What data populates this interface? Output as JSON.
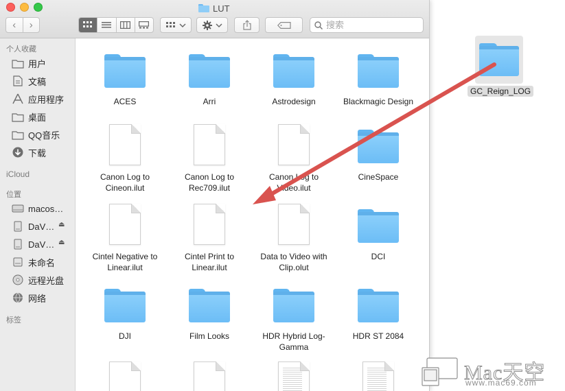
{
  "window": {
    "title": "LUT"
  },
  "toolbar": {
    "back_label": "‹",
    "forward_label": "›",
    "search_placeholder": "搜索"
  },
  "sidebar": {
    "favorites_header": "个人收藏",
    "favorites": [
      {
        "label": "用户",
        "icon": "home-icon"
      },
      {
        "label": "文稿",
        "icon": "document-icon"
      },
      {
        "label": "应用程序",
        "icon": "applications-icon"
      },
      {
        "label": "桌面",
        "icon": "desktop-icon"
      },
      {
        "label": "QQ音乐",
        "icon": "folder-icon"
      },
      {
        "label": "下载",
        "icon": "download-icon"
      }
    ],
    "icloud_header": "iCloud",
    "locations_header": "位置",
    "locations": [
      {
        "label": "macos…",
        "icon": "hard-drive-icon"
      },
      {
        "label": "DaV…",
        "icon": "disk-icon",
        "eject": true
      },
      {
        "label": "DaV…",
        "icon": "disk-icon",
        "eject": true
      },
      {
        "label": "未命名",
        "icon": "disk-icon"
      },
      {
        "label": "远程光盘",
        "icon": "remote-disc-icon"
      },
      {
        "label": "网络",
        "icon": "network-icon"
      }
    ],
    "tags_header": "标签"
  },
  "files": [
    {
      "name": "ACES",
      "kind": "folder"
    },
    {
      "name": "Arri",
      "kind": "folder"
    },
    {
      "name": "Astrodesign",
      "kind": "folder"
    },
    {
      "name": "Blackmagic Design",
      "kind": "folder"
    },
    {
      "name": "Canon Log to Cineon.ilut",
      "kind": "document"
    },
    {
      "name": "Canon Log to Rec709.ilut",
      "kind": "document"
    },
    {
      "name": "Canon Log to Video.ilut",
      "kind": "document"
    },
    {
      "name": "CineSpace",
      "kind": "folder"
    },
    {
      "name": "Cintel Negative to Linear.ilut",
      "kind": "document"
    },
    {
      "name": "Cintel Print to Linear.ilut",
      "kind": "document"
    },
    {
      "name": "Data to Video with Clip.olut",
      "kind": "document"
    },
    {
      "name": "DCI",
      "kind": "folder"
    },
    {
      "name": "DJI",
      "kind": "folder"
    },
    {
      "name": "Film Looks",
      "kind": "folder"
    },
    {
      "name": "HDR Hybrid Log-Gamma",
      "kind": "folder"
    },
    {
      "name": "HDR ST 2084",
      "kind": "folder"
    },
    {
      "name": "",
      "kind": "document"
    },
    {
      "name": "",
      "kind": "document"
    },
    {
      "name": "",
      "kind": "text-document"
    },
    {
      "name": "",
      "kind": "text-document"
    }
  ],
  "dragged_item": {
    "name": "GC_Reign_LOG",
    "kind": "folder"
  },
  "watermark": {
    "brand": "Mac天空",
    "site": "www.mac69.com"
  },
  "colors": {
    "folder_blue": "#6cbdf6",
    "arrow_red": "#d9534f",
    "sidebar_bg": "#ebebeb"
  }
}
